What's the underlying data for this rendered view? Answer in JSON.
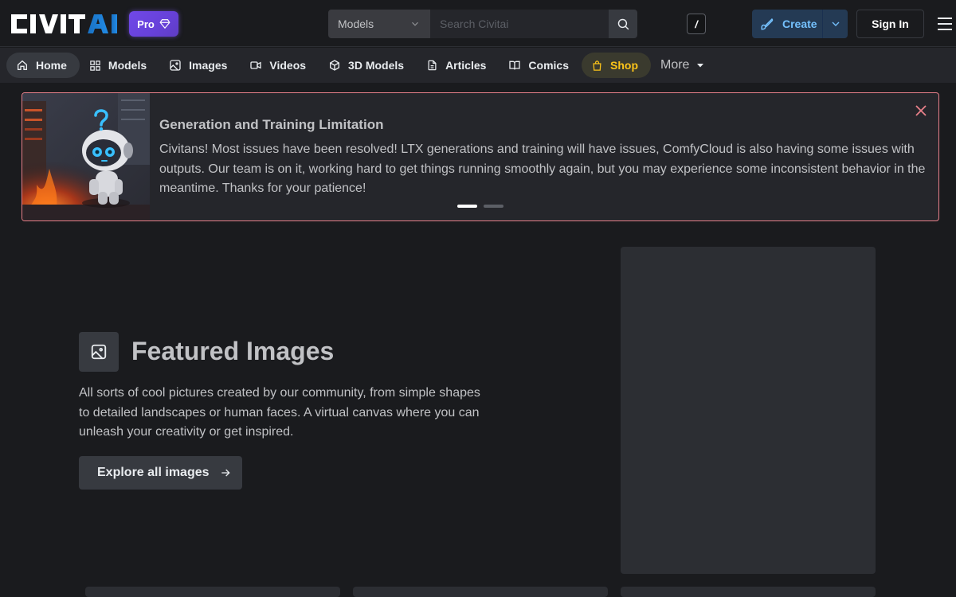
{
  "header": {
    "logo_text": "CIVITAI",
    "pro_label": "Pro",
    "search": {
      "category": "Models",
      "placeholder": "Search Civitai",
      "shortcut": "/"
    },
    "create_label": "Create",
    "signin_label": "Sign In"
  },
  "nav": {
    "items": [
      {
        "label": "Home",
        "icon": "home-icon"
      },
      {
        "label": "Models",
        "icon": "grid-icon"
      },
      {
        "label": "Images",
        "icon": "image-icon"
      },
      {
        "label": "Videos",
        "icon": "video-icon"
      },
      {
        "label": "3D Models",
        "icon": "cube-icon"
      },
      {
        "label": "Articles",
        "icon": "article-icon"
      },
      {
        "label": "Comics",
        "icon": "book-icon"
      },
      {
        "label": "Shop",
        "icon": "shopping-bag-icon"
      }
    ],
    "more_label": "More"
  },
  "announcement": {
    "title": "Generation and Training Limitation",
    "body": "Civitans! Most issues have been resolved! LTX generations and training will have issues, ComfyCloud is also having some issues with outputs. Our team is on it, working hard to get things running smoothly again, but you may experience some inconsistent behavior in the meantime. Thanks for your patience!",
    "slide_count": 2,
    "active_slide": 1
  },
  "featured": {
    "title": "Featured Images",
    "description": "All sorts of cool pictures created by our community, from simple shapes to detailed landscapes or human faces. A virtual canvas where you can unleash your creativity or get inspired.",
    "explore_label": "Explore all images"
  },
  "colors": {
    "background": "#1a1b1e",
    "pro_gradient": "#7048e8",
    "create_text": "#74c0fc",
    "shop_text": "#fcc419",
    "announce_border": "#e8808a"
  }
}
